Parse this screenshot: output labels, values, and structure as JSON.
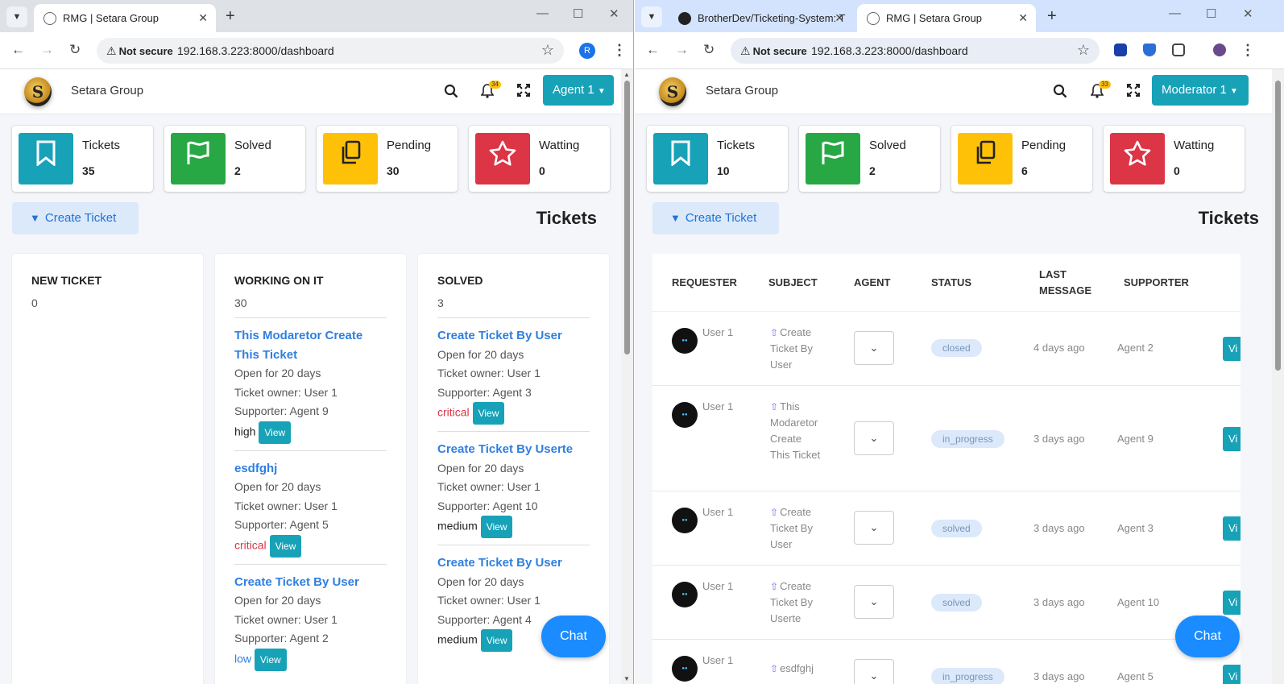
{
  "left": {
    "browser": {
      "tabs": [
        {
          "title": "RMG | Setara Group",
          "active": true
        }
      ],
      "not_secure": "Not secure",
      "url": "192.168.3.223:8000/dashboard",
      "profile_initial": "R"
    },
    "app": {
      "brand": "Setara Group",
      "notif_count": "34",
      "user_menu": "Agent 1"
    },
    "cards": [
      {
        "label": "Tickets",
        "value": "35",
        "color": "#17a2b8",
        "icon": "bookmark-icon"
      },
      {
        "label": "Solved",
        "value": "2",
        "color": "#28a745",
        "icon": "flag-icon"
      },
      {
        "label": "Pending",
        "value": "30",
        "color": "#ffc107",
        "icon": "copy-icon"
      },
      {
        "label": "Watting",
        "value": "0",
        "color": "#dc3545",
        "icon": "star-icon"
      }
    ],
    "create_ticket": "Create Ticket",
    "tickets_heading": "Tickets",
    "columns": [
      {
        "title": "NEW TICKET",
        "count": "0",
        "items": []
      },
      {
        "title": "WORKING ON IT",
        "count": "30",
        "items": [
          {
            "title": "This Modaretor Create This Ticket",
            "open": "Open for 20 days",
            "owner": "Ticket owner: User 1",
            "supporter": "Supporter: Agent 9",
            "priority": "high"
          },
          {
            "title": "esdfghj",
            "open": "Open for 20 days",
            "owner": "Ticket owner: User 1",
            "supporter": "Supporter: Agent 5",
            "priority": "critical"
          },
          {
            "title": "Create Ticket By User",
            "open": "Open for 20 days",
            "owner": "Ticket owner: User 1",
            "supporter": "Supporter: Agent 2",
            "priority": "low"
          }
        ]
      },
      {
        "title": "SOLVED",
        "count": "3",
        "items": [
          {
            "title": "Create Ticket By User",
            "open": "Open for 20 days",
            "owner": "Ticket owner: User 1",
            "supporter": "Supporter: Agent 3",
            "priority": "critical"
          },
          {
            "title": "Create Ticket By Userte",
            "open": "Open for 20 days",
            "owner": "Ticket owner: User 1",
            "supporter": "Supporter: Agent 10",
            "priority": "medium"
          },
          {
            "title": "Create Ticket By User",
            "open": "Open for 20 days",
            "owner": "Ticket owner: User 1",
            "supporter": "Supporter: Agent 4",
            "priority": "medium"
          }
        ]
      }
    ],
    "view_label": "View",
    "chat": "Chat"
  },
  "right": {
    "browser": {
      "tabs": [
        {
          "title": "BrotherDev/Ticketing-System: T",
          "active": false
        },
        {
          "title": "RMG | Setara Group",
          "active": true
        }
      ],
      "not_secure": "Not secure",
      "url": "192.168.3.223:8000/dashboard"
    },
    "app": {
      "brand": "Setara Group",
      "notif_count": "33",
      "user_menu": "Moderator 1"
    },
    "cards": [
      {
        "label": "Tickets",
        "value": "10",
        "color": "#17a2b8",
        "icon": "bookmark-icon"
      },
      {
        "label": "Solved",
        "value": "2",
        "color": "#28a745",
        "icon": "flag-icon"
      },
      {
        "label": "Pending",
        "value": "6",
        "color": "#ffc107",
        "icon": "copy-icon"
      },
      {
        "label": "Watting",
        "value": "0",
        "color": "#dc3545",
        "icon": "star-icon"
      }
    ],
    "create_ticket": "Create Ticket",
    "tickets_heading": "Tickets",
    "table": {
      "headers": [
        "REQUESTER",
        "SUBJECT",
        "AGENT",
        "STATUS",
        "LAST MESSAGE",
        "SUPPORTER"
      ],
      "rows": [
        {
          "requester": "User 1",
          "subject": "Create Ticket By User",
          "status": "closed",
          "last_message": "4 days ago",
          "supporter": "Agent 2"
        },
        {
          "requester": "User 1",
          "subject": "This Modaretor Create This Ticket",
          "status": "in_progress",
          "last_message": "3 days ago",
          "supporter": "Agent 9"
        },
        {
          "requester": "User 1",
          "subject": "Create Ticket By User",
          "status": "solved",
          "last_message": "3 days ago",
          "supporter": "Agent 3"
        },
        {
          "requester": "User 1",
          "subject": "Create Ticket By Userte",
          "status": "solved",
          "last_message": "3 days ago",
          "supporter": "Agent 10"
        },
        {
          "requester": "User 1",
          "subject": "esdfghj",
          "status": "in_progress",
          "last_message": "3 days ago",
          "supporter": "Agent 5"
        }
      ],
      "view_label": "Vi"
    },
    "chat": "Chat"
  }
}
